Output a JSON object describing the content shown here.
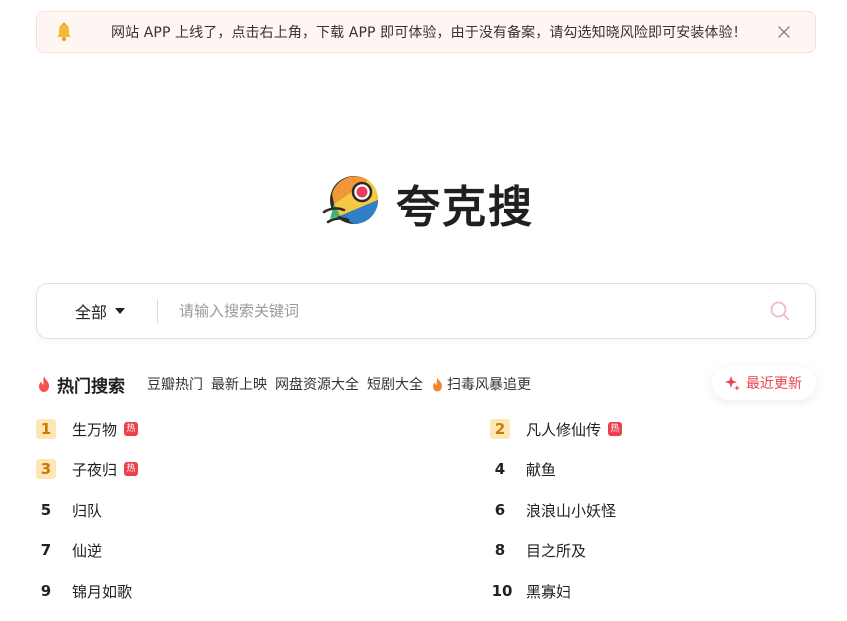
{
  "notice": {
    "text": "网站 APP 上线了，点击右上角，下载 APP 即可体验，由于没有备案，请勾选知晓风险即可安装体验！",
    "bell_icon": "bell-icon",
    "close_icon": "close-icon"
  },
  "brand": {
    "name": "夸克搜",
    "logo_icon": "rocket-planet-logo"
  },
  "search": {
    "scope_label": "全部",
    "placeholder": "请输入搜索关键词",
    "value": "",
    "search_icon": "search-icon"
  },
  "hot": {
    "title": "热门搜索",
    "tabs": [
      {
        "label": "豆瓣热门"
      },
      {
        "label": "最新上映"
      },
      {
        "label": "网盘资源大全"
      },
      {
        "label": "短剧大全"
      },
      {
        "label": "扫毒风暴追更",
        "icon": "flame-icon"
      }
    ],
    "recent_label": "最近更新",
    "badge_text": "热",
    "items": [
      {
        "rank": "1",
        "title": "生万物",
        "hot": true
      },
      {
        "rank": "2",
        "title": "凡人修仙传",
        "hot": true
      },
      {
        "rank": "3",
        "title": "子夜归",
        "hot": true
      },
      {
        "rank": "4",
        "title": "献鱼",
        "hot": false
      },
      {
        "rank": "5",
        "title": "归队",
        "hot": false
      },
      {
        "rank": "6",
        "title": "浪浪山小妖怪",
        "hot": false
      },
      {
        "rank": "7",
        "title": "仙逆",
        "hot": false
      },
      {
        "rank": "8",
        "title": "目之所及",
        "hot": false
      },
      {
        "rank": "9",
        "title": "锦月如歌",
        "hot": false
      },
      {
        "rank": "10",
        "title": "黑寡妇",
        "hot": false
      }
    ]
  },
  "colors": {
    "accent": "#e8454f",
    "notice_bg": "#fff6f3",
    "rank_top_bg": "#fde7b5",
    "rank_top_fg": "#c77a06",
    "hot_badge": "#ee3f4d"
  }
}
